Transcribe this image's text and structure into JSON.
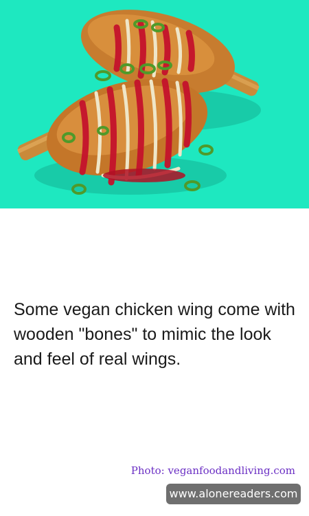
{
  "image": {
    "subject": "vegan chicken wings with wooden bones",
    "background_color": "#1ee8c0"
  },
  "caption": {
    "text": "Some vegan chicken wing come with wooden \"bones\" to mimic the look and feel of real wings."
  },
  "credit": {
    "text": "Photo: veganfoodandliving.com",
    "color": "#6b2fc4"
  },
  "watermark": {
    "text": "www.alonereaders.com"
  }
}
